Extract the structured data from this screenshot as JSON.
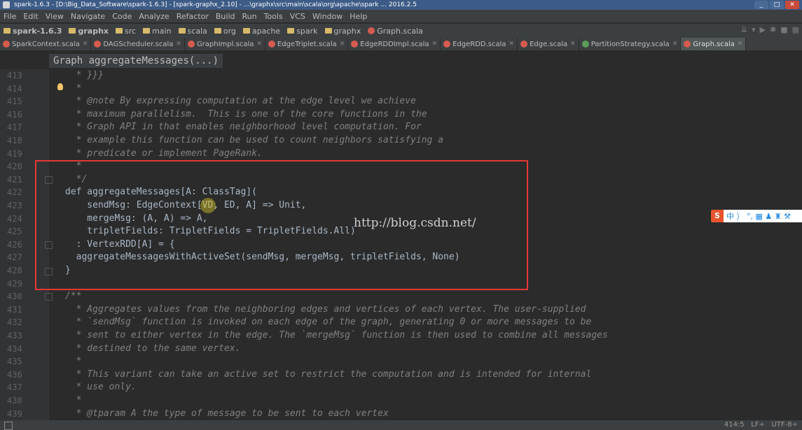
{
  "window": {
    "title": "spark-1.6.3 - [D:\\Big_Data_Software\\spark-1.6.3] - [spark-graphx_2.10] - ...\\graphx\\src\\main\\scala\\org\\apache\\spark ... 2016.2.5"
  },
  "menu": [
    "File",
    "Edit",
    "View",
    "Navigate",
    "Code",
    "Analyze",
    "Refactor",
    "Build",
    "Run",
    "Tools",
    "VCS",
    "Window",
    "Help"
  ],
  "breadcrumbs": [
    "spark-1.6.3",
    "graphx",
    "src",
    "main",
    "scala",
    "org",
    "apache",
    "spark",
    "graphx",
    "Graph.scala"
  ],
  "tabs": [
    {
      "label": "SparkContext.scala",
      "active": false
    },
    {
      "label": "DAGScheduler.scala",
      "active": false
    },
    {
      "label": "GraphImpl.scala",
      "active": false
    },
    {
      "label": "EdgeTriplet.scala",
      "active": false
    },
    {
      "label": "EdgeRDDImpl.scala",
      "active": false
    },
    {
      "label": "EdgeRDD.scala",
      "active": false
    },
    {
      "label": "Edge.scala",
      "active": false
    },
    {
      "label": "PartitionStrategy.scala",
      "active": false
    },
    {
      "label": "Graph.scala",
      "active": true
    }
  ],
  "structure_crumb": {
    "class": "Graph",
    "method": "aggregateMessages(...)"
  },
  "code_lines": [
    {
      "n": "413",
      "text": "  * }}}"
    },
    {
      "n": "414",
      "text": "  *"
    },
    {
      "n": "415",
      "text": "  * @note By expressing computation at the edge level we achieve"
    },
    {
      "n": "416",
      "text": "  * maximum parallelism.  This is one of the core functions in the"
    },
    {
      "n": "417",
      "text": "  * Graph API in that enables neighborhood level computation. For"
    },
    {
      "n": "418",
      "text": "  * example this function can be used to count neighbors satisfying a"
    },
    {
      "n": "419",
      "text": "  * predicate or implement PageRank."
    },
    {
      "n": "420",
      "text": "  *"
    },
    {
      "n": "421",
      "text": "  */"
    },
    {
      "n": "422",
      "text": "def aggregateMessages[A: ClassTag]("
    },
    {
      "n": "423",
      "text": "    sendMsg: EdgeContext[VD, ED, A] => Unit,"
    },
    {
      "n": "424",
      "text": "    mergeMsg: (A, A) => A,"
    },
    {
      "n": "425",
      "text": "    tripletFields: TripletFields = TripletFields.All)"
    },
    {
      "n": "426",
      "text": "  : VertexRDD[A] = {"
    },
    {
      "n": "427",
      "text": "  aggregateMessagesWithActiveSet(sendMsg, mergeMsg, tripletFields, None)"
    },
    {
      "n": "428",
      "text": "}"
    },
    {
      "n": "429",
      "text": ""
    },
    {
      "n": "430",
      "text": "/**"
    },
    {
      "n": "431",
      "text": "  * Aggregates values from the neighboring edges and vertices of each vertex. The user-supplied"
    },
    {
      "n": "432",
      "text": "  * `sendMsg` function is invoked on each edge of the graph, generating 0 or more messages to be"
    },
    {
      "n": "433",
      "text": "  * sent to either vertex in the edge. The `mergeMsg` function is then used to combine all messages"
    },
    {
      "n": "434",
      "text": "  * destined to the same vertex."
    },
    {
      "n": "435",
      "text": "  *"
    },
    {
      "n": "436",
      "text": "  * This variant can take an active set to restrict the computation and is intended for internal"
    },
    {
      "n": "437",
      "text": "  * use only."
    },
    {
      "n": "438",
      "text": "  *"
    },
    {
      "n": "439",
      "text": "  * @tparam A the type of message to be sent to each vertex"
    }
  ],
  "watermark": "http://blog.csdn.net/",
  "ime": {
    "logo": "S",
    "text": "中 ） °, ▦ ♟ ♜ ⚒"
  },
  "status": {
    "position": "414:5",
    "line_sep": "LF÷",
    "encoding": "UTF-8÷"
  },
  "colors": {
    "background": "#2b2b2b",
    "keyword": "#cc7832",
    "function": "#ffc66d",
    "comment": "#629755",
    "highlight_box": "#e53935"
  }
}
